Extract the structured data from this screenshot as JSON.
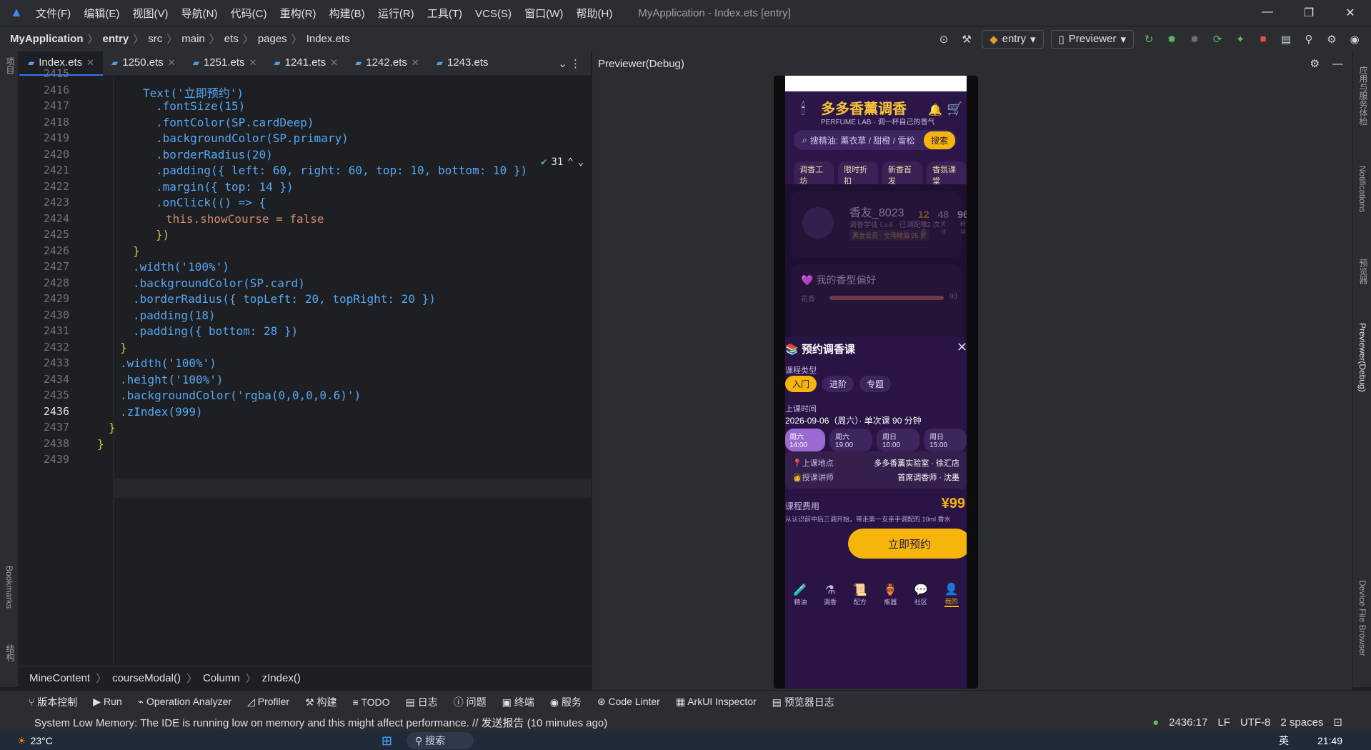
{
  "titlebar": {
    "menus": [
      "文件(F)",
      "编辑(E)",
      "视图(V)",
      "导航(N)",
      "代码(C)",
      "重构(R)",
      "构建(B)",
      "运行(R)",
      "工具(T)",
      "VCS(S)",
      "窗口(W)",
      "帮助(H)"
    ],
    "window_title": "MyApplication - Index.ets [entry]"
  },
  "navbar": {
    "crumbs": [
      "MyApplication",
      "entry",
      "src",
      "main",
      "ets",
      "pages",
      "Index.ets"
    ],
    "run_config": "entry",
    "device": "Previewer"
  },
  "tabs": [
    "Index.ets",
    "1250.ets",
    "1251.ets",
    "1241.ets",
    "1242.ets",
    "1243.ets"
  ],
  "editor": {
    "inspection_count": "31",
    "lines": [
      {
        "n": "2415",
        "t": ""
      },
      {
        "n": "2416",
        "t": "Text('立即预约')"
      },
      {
        "n": "2417",
        "t": ".fontSize(15)"
      },
      {
        "n": "2418",
        "t": ".fontColor(SP.cardDeep)"
      },
      {
        "n": "2419",
        "t": ".backgroundColor(SP.primary)"
      },
      {
        "n": "2420",
        "t": ".borderRadius(20)"
      },
      {
        "n": "2421",
        "t": ".padding({ left: 60, right: 60, top: 10, bottom: 10 })"
      },
      {
        "n": "2422",
        "t": ".margin({ top: 14 })"
      },
      {
        "n": "2423",
        "t": ".onClick(() => {"
      },
      {
        "n": "2424",
        "t": "this.showCourse = false"
      },
      {
        "n": "2425",
        "t": "})"
      },
      {
        "n": "2426",
        "t": "}"
      },
      {
        "n": "2427",
        "t": ".width('100%')"
      },
      {
        "n": "2428",
        "t": ".backgroundColor(SP.card)"
      },
      {
        "n": "2429",
        "t": ".borderRadius({ topLeft: 20, topRight: 20 })"
      },
      {
        "n": "2430",
        "t": ".padding(18)"
      },
      {
        "n": "2431",
        "t": ".padding({ bottom: 28 })"
      },
      {
        "n": "2432",
        "t": "}"
      },
      {
        "n": "2433",
        "t": ".width('100%')"
      },
      {
        "n": "2434",
        "t": ".height('100%')"
      },
      {
        "n": "2435",
        "t": ".backgroundColor('rgba(0,0,0,0.6)')"
      },
      {
        "n": "2436",
        "t": ".zIndex(999)"
      },
      {
        "n": "2437",
        "t": "}"
      },
      {
        "n": "2438",
        "t": "}"
      },
      {
        "n": "2439",
        "t": ""
      }
    ]
  },
  "code_breadcrumb": [
    "MineContent",
    "courseModal()",
    "Column",
    "zIndex()"
  ],
  "toolwindows": [
    "版本控制",
    "Run",
    "Operation Analyzer",
    "Profiler",
    "构建",
    "TODO",
    "日志",
    "问题",
    "终端",
    "服务",
    "Code Linter",
    "ArkUI Inspector",
    "预览器日志"
  ],
  "status": {
    "message": "System Low Memory: The IDE is running low on memory and this might affect performance. // 发送报告 (10 minutes ago)",
    "position": "2436:17",
    "line_sep": "LF",
    "encoding": "UTF-8",
    "indent": "2 spaces"
  },
  "previewer": {
    "title": "Previewer(Debug)",
    "app": {
      "brand": "多多香薰调香",
      "brand_sub": "PERFUME LAB · 调一杯自己的香气",
      "search_placeholder": "搜精油: 薰衣草 / 甜橙 / 雪松",
      "search_btn": "搜索",
      "chips": [
        "调香工坊",
        "限时折扣",
        "新香首发",
        "香氛课堂"
      ],
      "user_name": "香友_8023",
      "user_sub": "调香学徒 Lv.6 · 已调配 32 次",
      "user_badge": "黑金会员 · 全场精油 95 折",
      "stats": [
        {
          "v": "12",
          "l": "配方"
        },
        {
          "v": "48",
          "l": "关注"
        },
        {
          "v": "96",
          "l": "粉丝"
        }
      ],
      "pref_title": "我的香型偏好",
      "pref_label": "花香",
      "pref_value": "90"
    },
    "sheet": {
      "title": "预约调香课",
      "type_label": "课程类型",
      "types": [
        "入门",
        "进阶",
        "专题"
      ],
      "time_label": "上课时间",
      "time_value": "2026-09-06（周六）· 单次课 90 分钟",
      "slots": [
        "周六 14:00",
        "周六 19:00",
        "周日 10:00",
        "周日 15:00"
      ],
      "place_label": "上课地点",
      "place_value": "多多香薰实验室 · 徐汇店",
      "teacher_label": "授课讲师",
      "teacher_value": "首席调香师 · 沈墨",
      "fee_label": "课程费用",
      "fee_value": "¥99",
      "fee_desc": "从认识前中后三调开始，带走第一支亲手调配的 10ml 香水",
      "book_btn": "立即预约"
    },
    "tabbar": [
      "精油",
      "调香",
      "配方",
      "瓶器",
      "社区",
      "我的"
    ]
  },
  "taskbar": {
    "weather": "23°C",
    "search": "搜索",
    "time": "21:49",
    "lang": "英"
  },
  "colors": {
    "accent": "#3574f0",
    "gold": "#f5b50a",
    "sheet_bg": "#2a1445"
  }
}
